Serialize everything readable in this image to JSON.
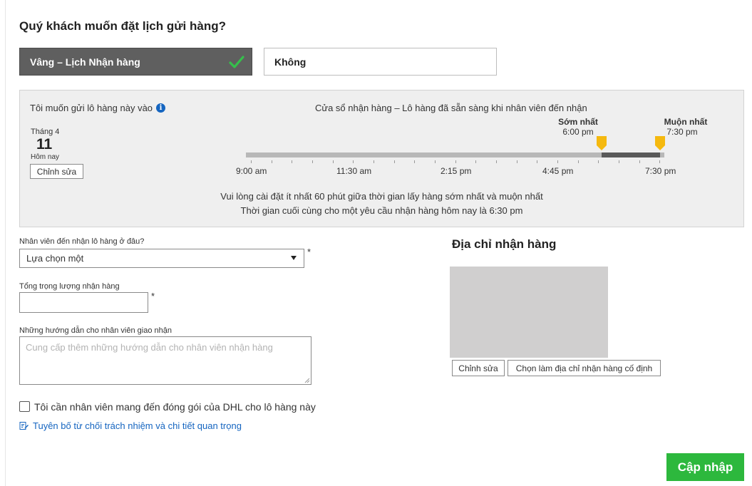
{
  "page": {
    "title": "Quý khách muốn đặt lịch gửi hàng?"
  },
  "schedule_options": {
    "yes_label": "Vâng – Lịch Nhận hàng",
    "no_label": "Không",
    "selected": "yes"
  },
  "pickup_panel": {
    "send_label": "Tôi muốn gửi lô hàng này vào",
    "date": {
      "month": "Tháng 4",
      "day": "11",
      "relative": "Hôm nay",
      "edit_label": "Chỉnh sửa"
    },
    "window_title": "Cửa sổ nhận hàng – Lô hàng đã sẵn sàng khi nhân viên đến nhận",
    "earliest": {
      "label": "Sớm nhất",
      "time": "6:00 pm"
    },
    "latest": {
      "label": "Muộn nhất",
      "time": "7:30 pm"
    },
    "timeline_labels": [
      "9:00 am",
      "11:30 am",
      "2:15 pm",
      "4:45 pm",
      "7:30 pm"
    ],
    "note_min_gap": "Vui lòng cài đặt ít nhất 60 phút giữa thời gian lấy hàng sớm nhất và muộn nhất",
    "note_cutoff": "Thời gian cuối cùng cho một yêu cầu nhận hàng hôm nay là 6:30 pm"
  },
  "form": {
    "location_label": "Nhân viên đến nhận lô hàng ở đâu?",
    "location_value": "Lựa chọn một",
    "weight_label": "Tổng trọng lượng nhận hàng",
    "weight_value": "",
    "instructions_label": "Những hướng dẫn cho nhân viên giao nhận",
    "instructions_placeholder": "Cung cấp thêm những hướng dẫn cho nhân viên nhận hàng",
    "required_mark": "*",
    "packaging_label": "Tôi cần nhân viên mang đến đóng gói của DHL cho lô hàng này",
    "packaging_checked": false,
    "disclaimer_link": "Tuyên bố từ chối trách nhiệm và chi tiết quan trọng"
  },
  "address": {
    "title": "Địa chỉ nhận hàng",
    "edit_label": "Chỉnh sửa",
    "set_default_label": "Chọn làm địa chỉ nhận hàng cố định"
  },
  "actions": {
    "update_label": "Cập nhập"
  },
  "colors": {
    "selected_option": "#5f5f5f",
    "check": "#35c04b",
    "handle": "#f5b90f",
    "primary_button": "#2db83d",
    "link": "#1565c0"
  }
}
